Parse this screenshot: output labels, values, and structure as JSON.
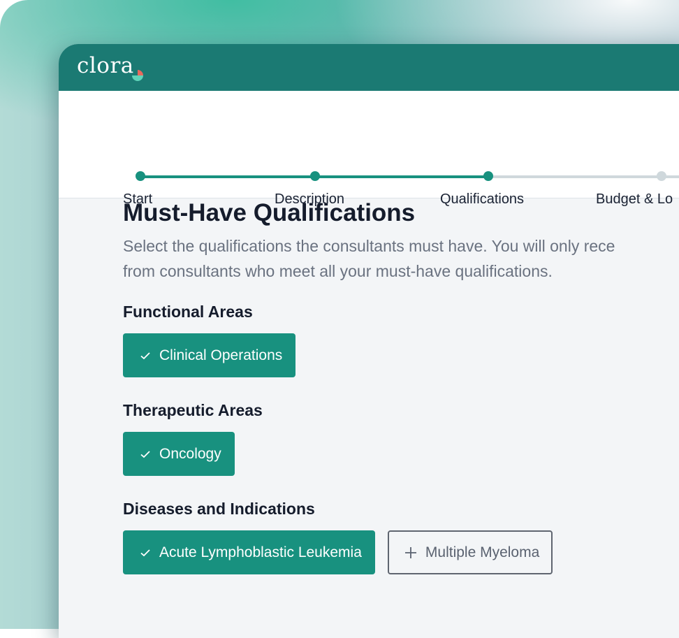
{
  "app": {
    "logo_text": "clora"
  },
  "colors": {
    "brand_teal": "#1b7a73",
    "accent_green": "#18917f",
    "inactive_step": "#cfd8dc"
  },
  "stepper": {
    "steps": [
      {
        "label": "Start",
        "state": "done"
      },
      {
        "label": "Description",
        "state": "done"
      },
      {
        "label": "Qualifications",
        "state": "current"
      },
      {
        "label": "Budget & Lo",
        "state": "upcoming"
      }
    ]
  },
  "page": {
    "title": "Must-Have Qualifications",
    "description_line1": "Select the qualifications the consultants must have. You will only rece",
    "description_line2": "from consultants who meet all your must-have qualifications."
  },
  "sections": [
    {
      "title": "Functional Areas",
      "chips": [
        {
          "label": "Clinical Operations",
          "selected": true,
          "icon": "check-icon"
        }
      ]
    },
    {
      "title": "Therapeutic Areas",
      "chips": [
        {
          "label": "Oncology",
          "selected": true,
          "icon": "check-icon"
        }
      ]
    },
    {
      "title": "Diseases and Indications",
      "chips": [
        {
          "label": "Acute Lymphoblastic Leukemia",
          "selected": true,
          "icon": "check-icon"
        },
        {
          "label": "Multiple Myeloma",
          "selected": false,
          "icon": "plus-icon"
        }
      ]
    }
  ]
}
